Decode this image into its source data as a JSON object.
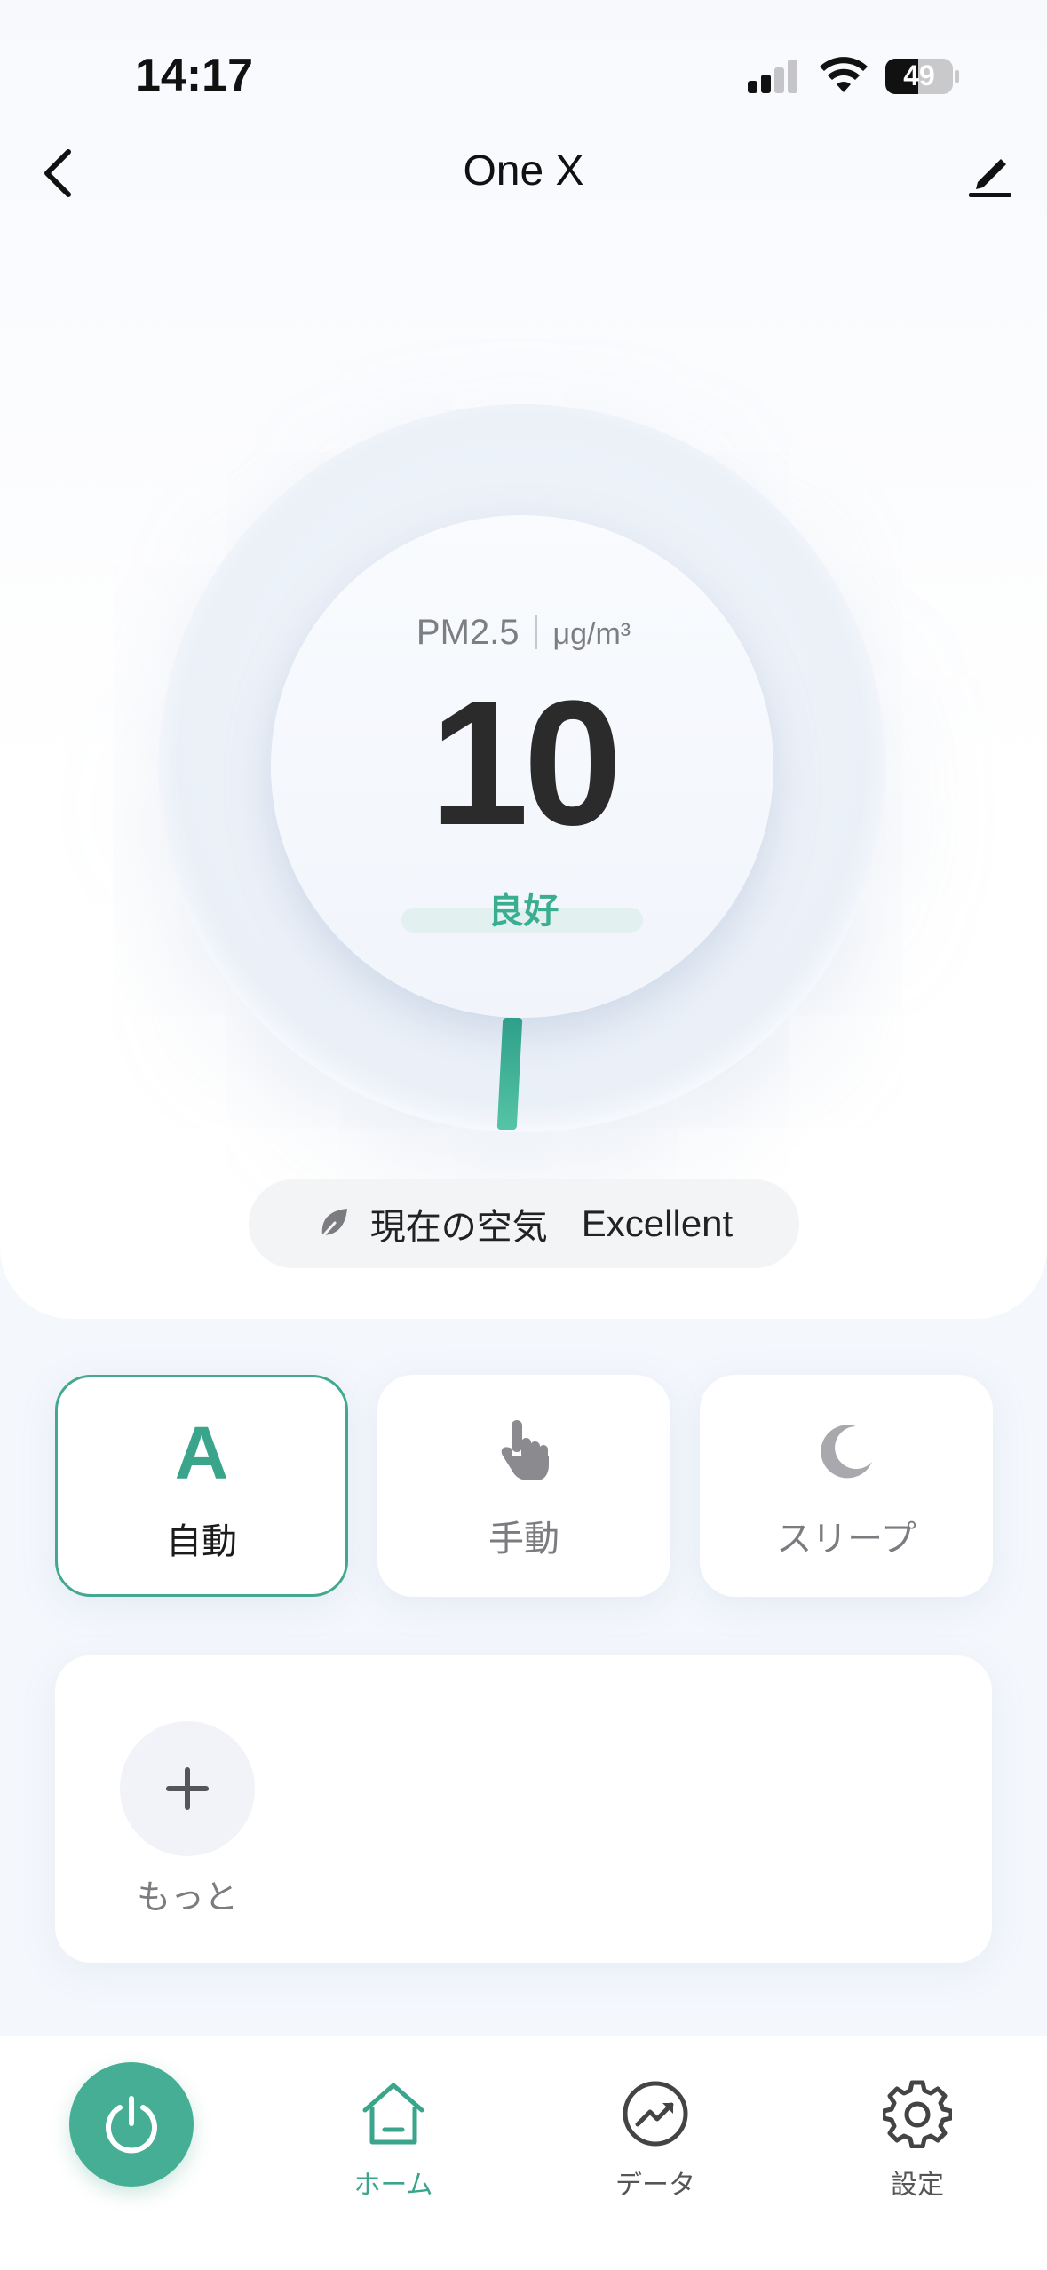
{
  "status_bar": {
    "time": "14:17",
    "battery": "49"
  },
  "nav": {
    "title": "One X"
  },
  "air_quality": {
    "pm_label": "PM2.5",
    "unit": "μg/m³",
    "value": "10",
    "quality": "良好",
    "accent_color": "#3aa58b"
  },
  "current_air": {
    "label": "現在の空気",
    "value": "Excellent"
  },
  "modes": [
    {
      "label": "自動",
      "icon": "auto-a-icon",
      "active": true
    },
    {
      "label": "手動",
      "icon": "hand-pointer-icon",
      "active": false
    },
    {
      "label": "スリープ",
      "icon": "moon-icon",
      "active": false
    }
  ],
  "more": {
    "label": "もっと"
  },
  "tabs": [
    {
      "label": "ホーム",
      "icon": "home-icon",
      "active": true
    },
    {
      "label": "データ",
      "icon": "chart-trend-icon",
      "active": false
    },
    {
      "label": "設定",
      "icon": "gear-icon",
      "active": false
    }
  ]
}
